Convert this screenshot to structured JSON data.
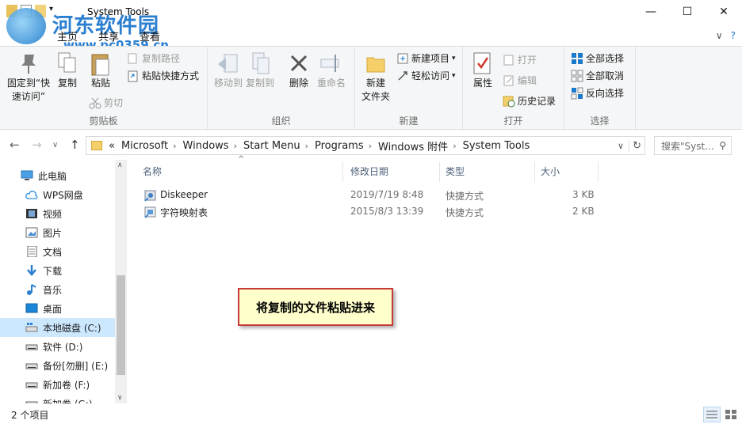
{
  "window": {
    "title": "System Tools",
    "minimize": "—",
    "maximize": "☐",
    "close": "✕"
  },
  "watermark": {
    "site_name": "河东软件园",
    "url": "www.pc0359.cn"
  },
  "ribbon_tabs": [
    "主页",
    "共享",
    "查看"
  ],
  "ribbon": {
    "clipboard": {
      "label": "剪贴板",
      "pin": "固定到“快\n速访问”",
      "copy": "复制",
      "paste": "粘贴",
      "copy_path": "复制路径",
      "paste_shortcut": "粘贴快捷方式",
      "cut": "剪切"
    },
    "organize": {
      "label": "组织",
      "move_to": "移动到",
      "copy_to": "复制到",
      "delete": "删除",
      "rename": "重命名"
    },
    "new": {
      "label": "新建",
      "new_folder": "新建\n文件夹",
      "new_item": "新建项目",
      "easy_access": "轻松访问"
    },
    "open": {
      "label": "打开",
      "properties": "属性",
      "open": "打开",
      "edit": "编辑",
      "history": "历史记录"
    },
    "select": {
      "label": "选择",
      "select_all": "全部选择",
      "select_none": "全部取消",
      "invert": "反向选择"
    }
  },
  "address_bar": {
    "overflow": "«",
    "crumbs": [
      "Microsoft",
      "Windows",
      "Start Menu",
      "Programs",
      "Windows 附件",
      "System Tools"
    ],
    "search_placeholder": "搜索\"Syst..."
  },
  "nav_pane": {
    "items": [
      {
        "label": "此电脑",
        "icon": "computer-icon"
      },
      {
        "label": "WPS网盘",
        "icon": "cloud-icon"
      },
      {
        "label": "视频",
        "icon": "video-icon"
      },
      {
        "label": "图片",
        "icon": "picture-icon"
      },
      {
        "label": "文档",
        "icon": "document-icon"
      },
      {
        "label": "下载",
        "icon": "download-icon"
      },
      {
        "label": "音乐",
        "icon": "music-icon"
      },
      {
        "label": "桌面",
        "icon": "desktop-icon"
      },
      {
        "label": "本地磁盘 (C:)",
        "icon": "drive-icon"
      },
      {
        "label": "软件 (D:)",
        "icon": "drive-icon"
      },
      {
        "label": "备份[勿删] (E:)",
        "icon": "drive-icon"
      },
      {
        "label": "新加卷 (F:)",
        "icon": "drive-icon"
      },
      {
        "label": "新加卷 (G:)",
        "icon": "drive-icon"
      }
    ],
    "selected_index": 8
  },
  "file_list": {
    "columns": [
      "名称",
      "修改日期",
      "类型",
      "大小"
    ],
    "rows": [
      {
        "name": "Diskeeper",
        "date": "2019/7/19 8:48",
        "type": "快捷方式",
        "size": "3 KB"
      },
      {
        "name": "字符映射表",
        "date": "2015/8/3 13:39",
        "type": "快捷方式",
        "size": "2 KB"
      }
    ]
  },
  "callout": "将复制的文件粘贴进来",
  "status": {
    "item_count": "2 个项目"
  },
  "colors": {
    "accent": "#1979ca",
    "selected": "#cce8ff",
    "callout_border": "#c83a3a",
    "callout_bg": "#ffffcc"
  }
}
